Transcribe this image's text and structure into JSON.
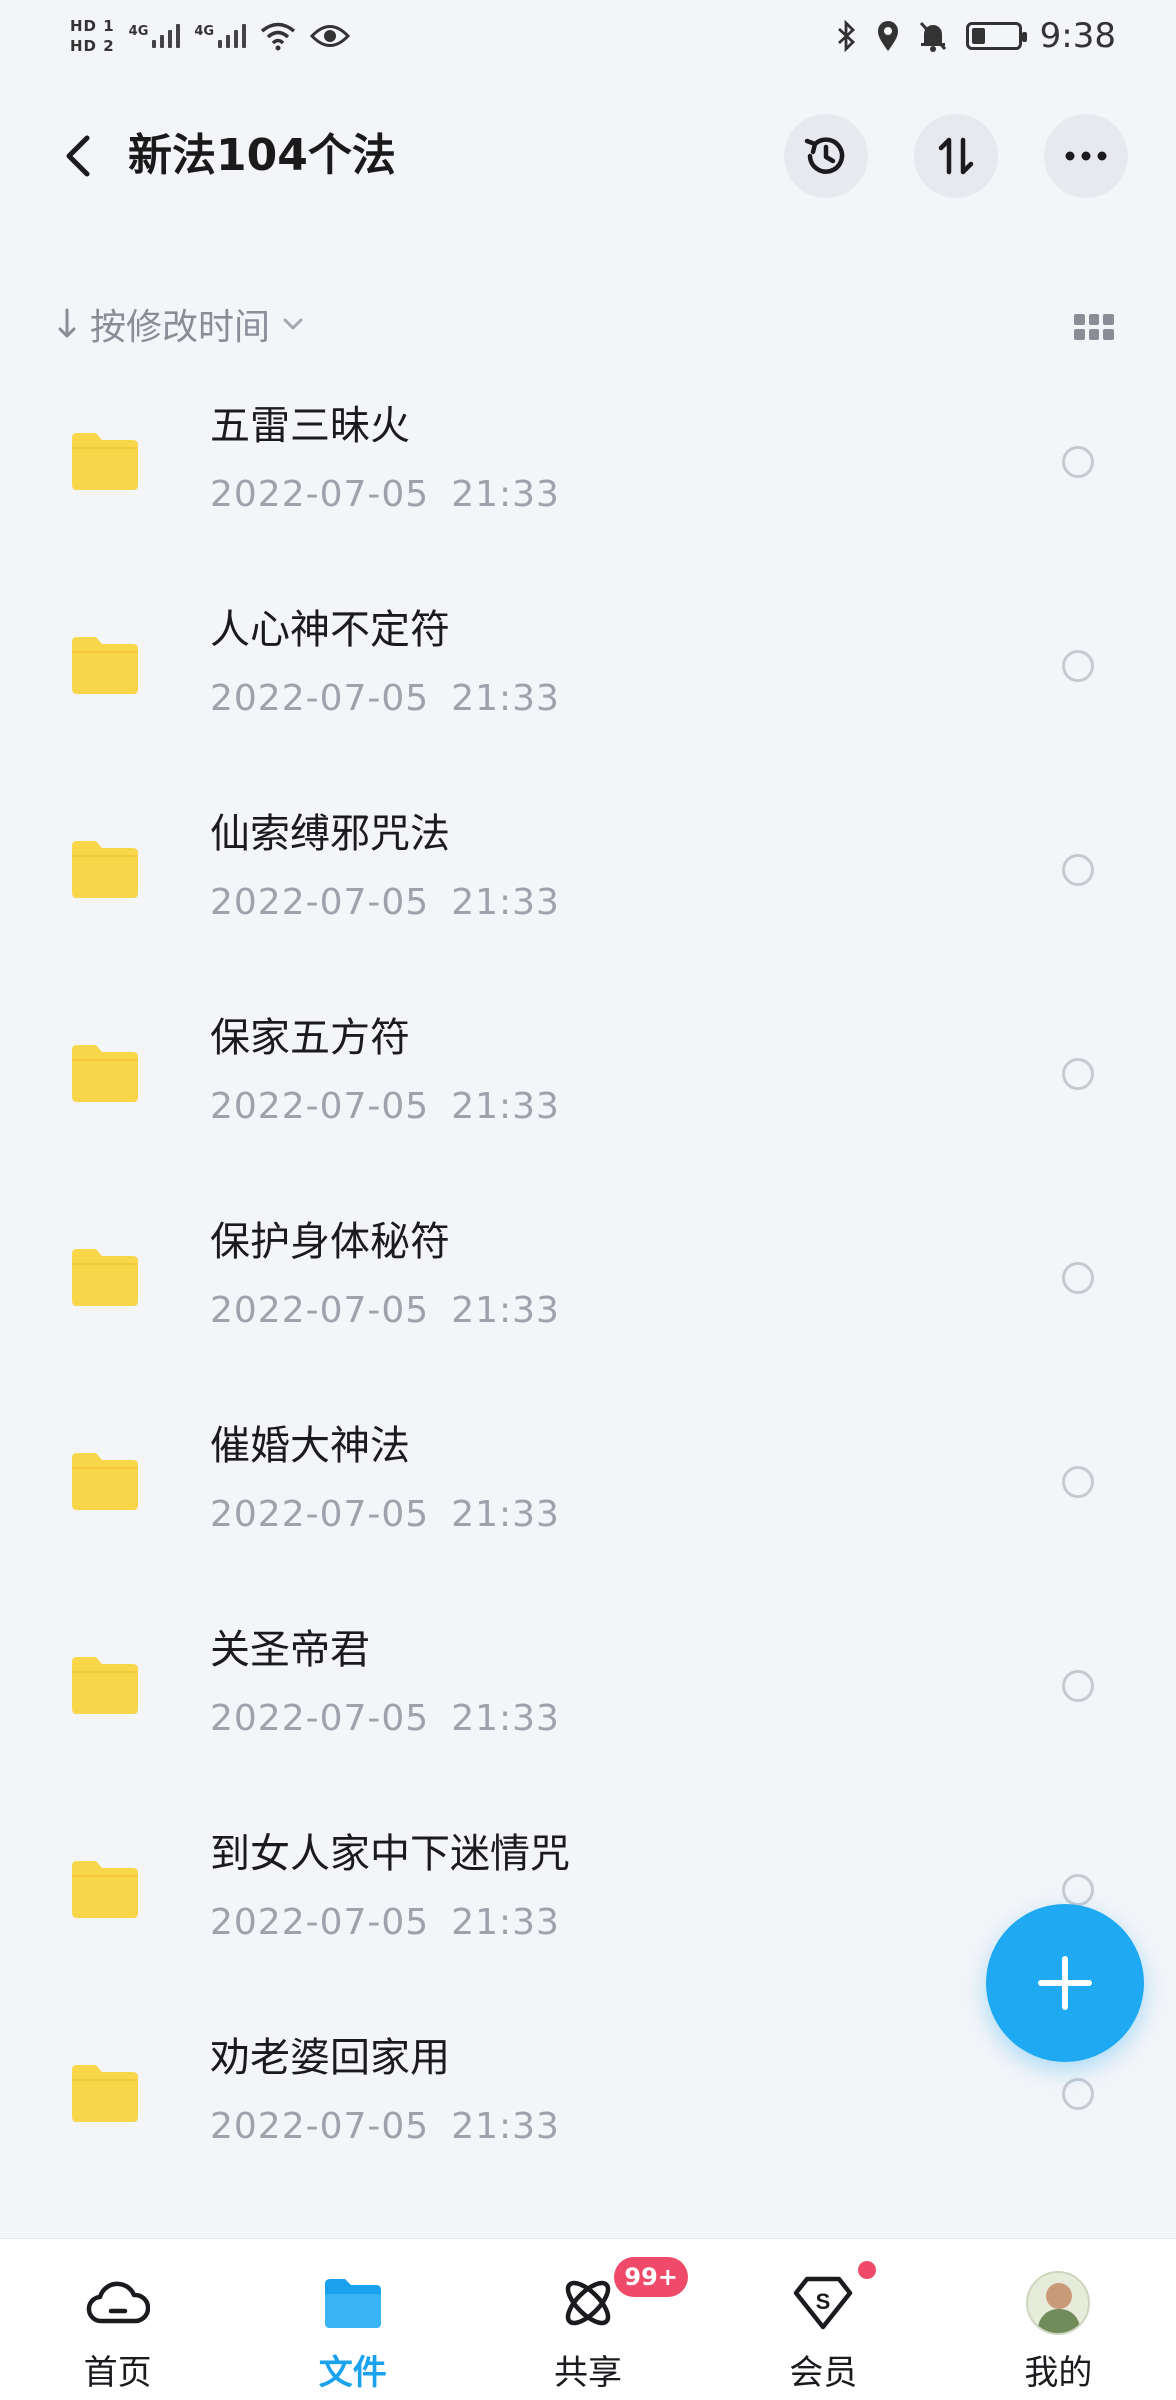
{
  "status_bar": {
    "hd1": "HD 1",
    "hd2": "HD 2",
    "net1": "4G",
    "net2": "4G",
    "time": "9:38",
    "icons": [
      "wifi-icon",
      "eye-icon",
      "bluetooth-icon",
      "location-icon",
      "mute-bell-icon",
      "battery-icon"
    ]
  },
  "header": {
    "title": "新法104个法",
    "back_icon": "chevron-left-icon",
    "actions": [
      "history-icon",
      "sort-swap-icon",
      "more-icon"
    ]
  },
  "sort": {
    "label": "按修改时间",
    "view_toggle_icon": "grid-view-icon"
  },
  "files": [
    {
      "name": "五雷三昧火",
      "date": "2022-07-05",
      "time": "21:33"
    },
    {
      "name": "人心神不定符",
      "date": "2022-07-05",
      "time": "21:33"
    },
    {
      "name": "仙索缚邪咒法",
      "date": "2022-07-05",
      "time": "21:33"
    },
    {
      "name": "保家五方符",
      "date": "2022-07-05",
      "time": "21:33"
    },
    {
      "name": "保护身体秘符",
      "date": "2022-07-05",
      "time": "21:33"
    },
    {
      "name": "催婚大神法",
      "date": "2022-07-05",
      "time": "21:33"
    },
    {
      "name": "关圣帝君",
      "date": "2022-07-05",
      "time": "21:33"
    },
    {
      "name": "到女人家中下迷情咒",
      "date": "2022-07-05",
      "time": "21:33"
    },
    {
      "name": "劝老婆回家用",
      "date": "2022-07-05",
      "time": "21:33"
    }
  ],
  "bottom_nav": {
    "tabs": [
      {
        "label": "首页",
        "icon": "cloud-icon"
      },
      {
        "label": "文件",
        "icon": "folder-icon"
      },
      {
        "label": "共享",
        "icon": "atom-icon",
        "badge": "99+"
      },
      {
        "label": "会员",
        "icon": "vip-shield-icon"
      },
      {
        "label": "我的",
        "icon": "avatar"
      }
    ],
    "active": "文件"
  },
  "colors": {
    "accent": "#1aa2ef",
    "fab": "#1ea9f2",
    "folder": "#f7d64a",
    "badge": "#ef4a6a",
    "background": "#f4f5f9"
  }
}
